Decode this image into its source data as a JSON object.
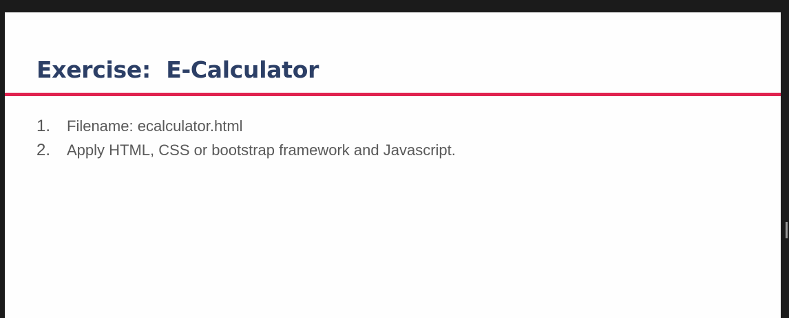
{
  "slide": {
    "title": "Exercise:  E-Calculator",
    "items": [
      {
        "number": "1.",
        "text": "Filename: ecalculator.html"
      },
      {
        "number": "2.",
        "text": "Apply HTML, CSS or bootstrap framework and Javascript."
      }
    ]
  },
  "colors": {
    "title": "#2c3f66",
    "rule": "#e0224f",
    "body_text": "#595959",
    "background": "#fefefe",
    "frame": "#1b1b1b"
  }
}
